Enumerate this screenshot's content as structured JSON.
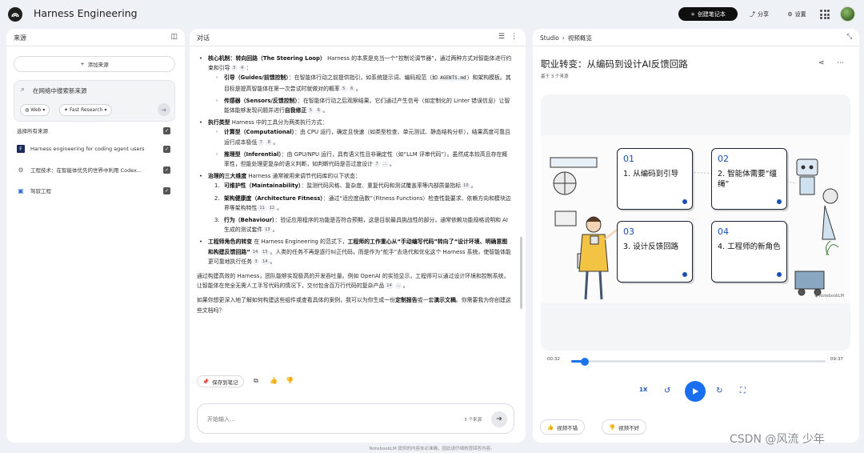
{
  "app": {
    "title": "Harness Engineering",
    "create_label": "创建笔记本",
    "share_label": "分享",
    "settings_label": "设置"
  },
  "sources": {
    "title": "来源",
    "add_label": "添加来源",
    "search_placeholder": "在网络中搜索新来源",
    "web_chip": "Web",
    "research_chip": "Fast Research",
    "select_all": "选择所有来源",
    "items": [
      {
        "label": "Harness engineering for coding agent users",
        "icon": "F"
      },
      {
        "label": "工程技术：在智能体优先的世界中利用 Codex...",
        "icon": "⚙"
      },
      {
        "label": "驾驭工程",
        "icon": "▣"
      }
    ]
  },
  "chat": {
    "title": "对话",
    "blocks": [
      {
        "b": "核心机制：转向回路（The Steering Loop）",
        "t": "Harness 的本质是充当一个“控制论调节器”，通过两种方式对智能体进行约束和引导",
        "c": [
          "3",
          "4"
        ]
      },
      {
        "b": "引导（Guides/前馈控制）",
        "t": "：在智能体行动之前提供指引，如系统提示词、编码规范（如 ",
        "m": "AGENTS.md",
        "t2": "）和架构模板。其目标是提高智能体在第一次尝试时就做对的概率",
        "c": [
          "5",
          "6"
        ]
      },
      {
        "b": "传感器（Sensors/反馈控制）",
        "t": "：在智能体行动之后观察结果。它们通过产生信号（如定制化的 Linter 错误信息）让智能体能够发现问题并进行",
        "b2": "自我修正",
        "c": [
          "5",
          "6"
        ]
      },
      {
        "b": "执行类型",
        "t": "Harness 中的工具分为两类执行方式："
      },
      {
        "b": "计算型（Computational）",
        "t": "：由 CPU 运行，确定且快速（如类型检查、单元测试、静态结构分析），结果高度可靠且运行成本极低",
        "c": [
          "7",
          "8"
        ]
      },
      {
        "b": "推理型（Inferential）",
        "t": "：由 GPU/NPU 运行，具有语义性且非确定性（如“LLM 评审代码”）。虽然成本较高且存在概率性，但能处理更复杂的语义判断，如判断代码是否过度设计",
        "c": [
          "7",
          "..."
        ]
      },
      {
        "b": "治理的三大维度",
        "t": "Harness 通常被用来调节代码库的以下状态："
      },
      {
        "n": "1.",
        "b": "可维护性（Maintainability）",
        "t": "：监测代码风格、复杂度、重复代码和测试覆盖率等内部质量指标",
        "c": [
          "10"
        ]
      },
      {
        "n": "2.",
        "b": "架构健康度（Architecture Fitness）",
        "t": "：通过“适应度函数”（Fitness Functions）检查性能要求、依赖方向和模块边界等架构特性",
        "c": [
          "11",
          "12"
        ]
      },
      {
        "n": "3.",
        "b": "行为（Behaviour）",
        "t": "：验证应用程序的功能是否符合预期，这是目前最具挑战性的部分，通常依赖功能规格说明和 AI 生成的测试套件",
        "c": [
          "13"
        ]
      },
      {
        "b": "工程师角色的转变",
        "t": "在 Harness Engineering 的范式下，",
        "b2": "工程师的工作重心从“手动编写代码”转向了“设计环境、明确意图和构建反馈回路”",
        "c": [
          "14",
          "15"
        ],
        "t3": "。人类的任务不再是逐行纠正代码，而是作为“舵手”去迭代和优化这个 Harness 系统，使智能体能更可靠地执行任务",
        "c2": [
          "3",
          "14"
        ]
      },
      {
        "t": "通过构建高效的 Harness，团队能够实现极高的开发吞吐量。例如 OpenAI 的实验显示，工程师可以通过设计环境和控制系统，让智能体在完全无需人工手写代码的情况下，交付包含百万行代码的复杂产品",
        "c": [
          "14",
          "..."
        ]
      },
      {
        "t": "如果你想更深入地了解如何构建这些组件或查看具体的案例，我可以为你生成一份",
        "b": "定制报告",
        "t2": "或一套",
        "b2": "演示文稿",
        "t3": "。你需要我为你创建这些文档吗？"
      }
    ],
    "save_note": "保存到笔记",
    "input_placeholder": "开始输入...",
    "source_count": "3 个来源"
  },
  "studio": {
    "crumb_root": "Studio",
    "crumb_page": "视频概览",
    "title": "职业转变：从编码到设计AI反馈回路",
    "subtitle": "基于 3 个来源",
    "cards": [
      {
        "num": "01",
        "text": "1. 从编码到引导"
      },
      {
        "num": "02",
        "text": "2. 智能体需要“缰绳”"
      },
      {
        "num": "03",
        "text": "3. 设计反馈回路"
      },
      {
        "num": "04",
        "text": "4. 工程师的新角色"
      }
    ],
    "watermark": "NotebookLM",
    "time_current": "00:32",
    "time_total": "09:37",
    "progress": 0.055,
    "speed": "1X",
    "thumb_up": "视频不错",
    "thumb_down": "视频不好"
  },
  "footer": "NotebookLM 提供的内容未必准确，因此请仔细核查回答内容。",
  "watermark_overlay": "CSDN @风流 少年"
}
